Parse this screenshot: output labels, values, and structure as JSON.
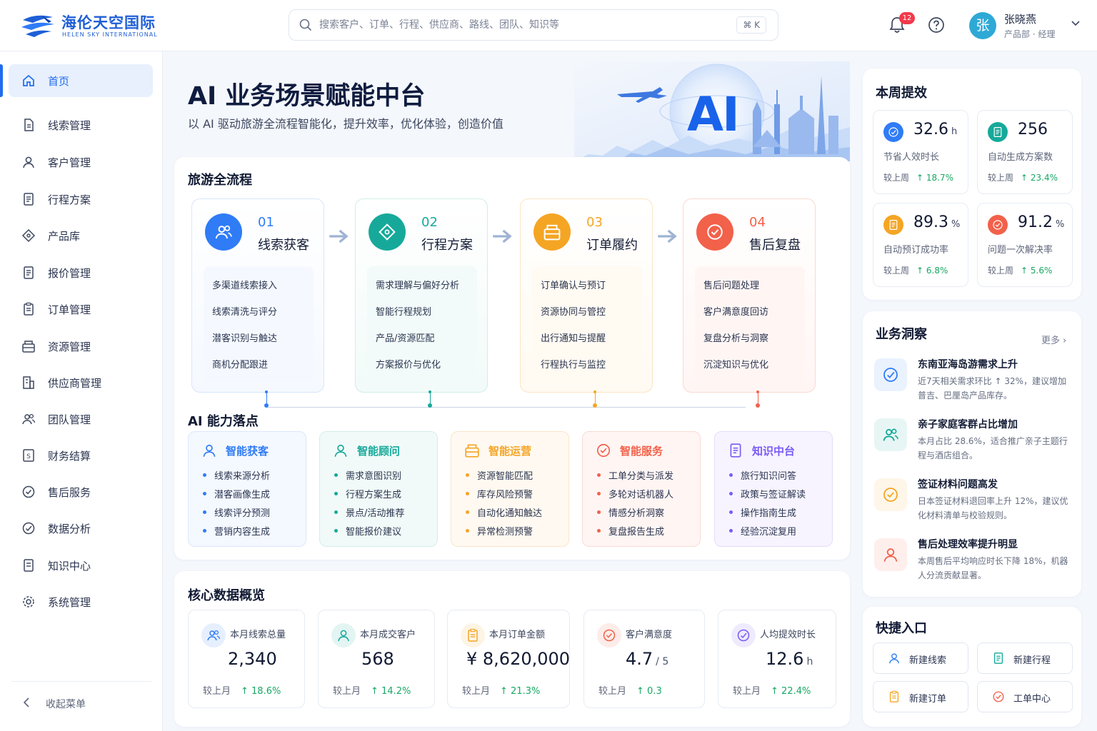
{
  "brand": {
    "name": "海伦天空国际",
    "sub": "HELEN SKY INTERNATIONAL",
    "color": "#1f5fd6"
  },
  "search": {
    "placeholder": "搜索客户、订单、行程、供应商、路线、团队、知识等",
    "shortcut": "⌘ K"
  },
  "notifications": {
    "count": "12"
  },
  "user": {
    "avatar": "张",
    "name": "张晓燕",
    "role": "产品部 · 经理"
  },
  "sidebar": {
    "items": [
      {
        "label": "首页",
        "icon": "home-icon"
      },
      {
        "label": "线索管理",
        "icon": "file-icon"
      },
      {
        "label": "客户管理",
        "icon": "user-icon"
      },
      {
        "label": "行程方案",
        "icon": "doc-icon"
      },
      {
        "label": "产品库",
        "icon": "tag-icon"
      },
      {
        "label": "报价管理",
        "icon": "doc-icon"
      },
      {
        "label": "订单管理",
        "icon": "clipboard-icon"
      },
      {
        "label": "资源管理",
        "icon": "box-icon"
      },
      {
        "label": "供应商管理",
        "icon": "building-icon"
      },
      {
        "label": "团队管理",
        "icon": "team-icon"
      },
      {
        "label": "财务结算",
        "icon": "money-icon"
      },
      {
        "label": "售后服务",
        "icon": "service-icon"
      },
      {
        "label": "数据分析",
        "icon": "check-icon"
      },
      {
        "label": "知识中心",
        "icon": "book-icon"
      },
      {
        "label": "系统管理",
        "icon": "gear-icon"
      }
    ],
    "collapse_label": "收起菜单"
  },
  "hero": {
    "title": "AI 业务场景赋能中台",
    "subtitle": "以 AI 驱动旅游全流程智能化，提升效率，优化体验，创造价值",
    "badge": "AI"
  },
  "flow": {
    "title": "旅游全流程",
    "steps": [
      {
        "num": "01",
        "name": "线索获客",
        "color": "#2f7cf6",
        "items": [
          "多渠道线索接入",
          "线索清洗与评分",
          "潜客识别与触达",
          "商机分配跟进"
        ]
      },
      {
        "num": "02",
        "name": "行程方案",
        "color": "#16a99a",
        "items": [
          "需求理解与偏好分析",
          "智能行程规划",
          "产品/资源匹配",
          "方案报价与优化"
        ]
      },
      {
        "num": "03",
        "name": "订单履约",
        "color": "#f5a524",
        "items": [
          "订单确认与预订",
          "资源协同与管控",
          "出行通知与提醒",
          "行程执行与监控"
        ]
      },
      {
        "num": "04",
        "name": "售后复盘",
        "color": "#f2614a",
        "items": [
          "售后问题处理",
          "客户满意度回访",
          "复盘分析与洞察",
          "沉淀知识与优化"
        ]
      }
    ]
  },
  "capabilities": {
    "title": "AI 能力落点",
    "groups": [
      {
        "name": "智能获客",
        "color": "#2f7cf6",
        "items": [
          "线索来源分析",
          "潜客画像生成",
          "线索评分预测",
          "营销内容生成"
        ]
      },
      {
        "name": "智能顾问",
        "color": "#16a99a",
        "items": [
          "需求意图识别",
          "行程方案生成",
          "景点/活动推荐",
          "智能报价建议"
        ]
      },
      {
        "name": "智能运营",
        "color": "#f5a524",
        "items": [
          "资源智能匹配",
          "库存风险预警",
          "自动化通知触达",
          "异常检测预警"
        ]
      },
      {
        "name": "智能服务",
        "color": "#f2614a",
        "items": [
          "工单分类与派发",
          "多轮对话机器人",
          "情感分析洞察",
          "复盘报告生成"
        ]
      },
      {
        "name": "知识中台",
        "color": "#7a5af5",
        "items": [
          "旅行知识问答",
          "政策与签证解读",
          "操作指南生成",
          "经验沉淀复用"
        ]
      }
    ]
  },
  "core_data": {
    "title": "核心数据概览",
    "compare_label": "较上月",
    "metrics": [
      {
        "label": "本月线索总量",
        "value": "2,340",
        "unit": "",
        "change": "↑ 18.6%",
        "color": "#2f7cf6"
      },
      {
        "label": "本月成交客户",
        "value": "568",
        "unit": "",
        "change": "↑ 14.2%",
        "color": "#16a99a"
      },
      {
        "label": "本月订单金额",
        "value": "¥ 8,620,000",
        "unit": "",
        "change": "↑ 21.3%",
        "color": "#f5a524"
      },
      {
        "label": "客户满意度",
        "value": "4.7",
        "unit": "/ 5",
        "change": "↑ 0.3",
        "color": "#f2614a"
      },
      {
        "label": "人均提效时长",
        "value": "12.6",
        "unit": "h",
        "change": "↑ 22.4%",
        "color": "#7a5af5"
      }
    ]
  },
  "weekly": {
    "title": "本周提效",
    "compare_label": "较上周",
    "items": [
      {
        "value": "32.6",
        "unit": "h",
        "label": "节省人效时长",
        "change": "↑ 18.7%",
        "color": "#2f7cf6"
      },
      {
        "value": "256",
        "unit": "",
        "label": "自动生成方案数",
        "change": "↑ 23.4%",
        "color": "#16a99a"
      },
      {
        "value": "89.3",
        "unit": "%",
        "label": "自动预订成功率",
        "change": "↑ 6.8%",
        "color": "#f5a524"
      },
      {
        "value": "91.2",
        "unit": "%",
        "label": "问题一次解决率",
        "change": "↑ 5.6%",
        "color": "#f2614a"
      }
    ]
  },
  "insights": {
    "title": "业务洞察",
    "more": "更多",
    "items": [
      {
        "title": "东南亚海岛游需求上升",
        "desc": "近7天相关需求环比 ↑ 32%，建议增加普吉、巴厘岛产品库存。",
        "color": "#2f7cf6"
      },
      {
        "title": "亲子家庭客群占比增加",
        "desc": "本月占比 28.6%，适合推广亲子主题行程与酒店组合。",
        "color": "#16a99a"
      },
      {
        "title": "签证材料问题高发",
        "desc": "日本签证材料退回率上升 12%，建议优化材料清单与校验规则。",
        "color": "#f5a524"
      },
      {
        "title": "售后处理效率提升明显",
        "desc": "本周售后平均响应时长下降 18%，机器人分流贡献显著。",
        "color": "#f2614a"
      }
    ]
  },
  "quick": {
    "title": "快捷入口",
    "items": [
      {
        "label": "新建线索",
        "color": "#2f7cf6"
      },
      {
        "label": "新建行程",
        "color": "#16a99a"
      },
      {
        "label": "新建订单",
        "color": "#f5a524"
      },
      {
        "label": "工单中心",
        "color": "#f2614a"
      }
    ]
  }
}
